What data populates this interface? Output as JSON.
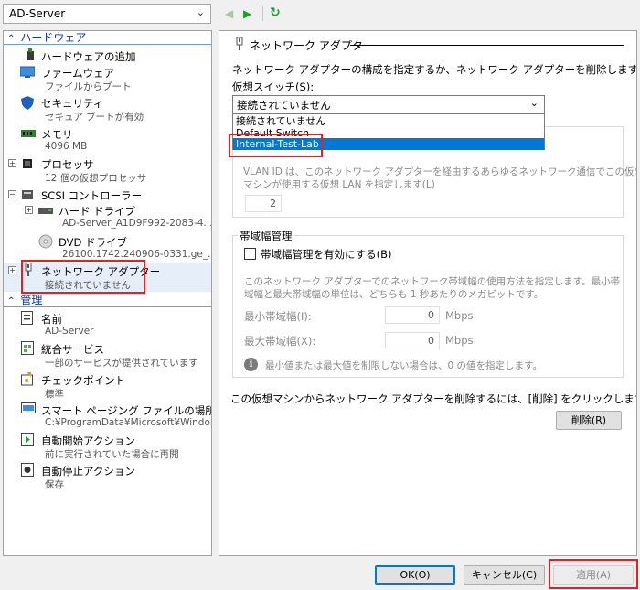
{
  "toolbar": {
    "vm_name": "AD-Server"
  },
  "left": {
    "hardware_header": "ハードウェア",
    "management_header": "管理",
    "hardware_items": [
      {
        "label": "ハードウェアの追加"
      },
      {
        "label": "ファームウェア",
        "sub": "ファイルからブート"
      },
      {
        "label": "セキュリティ",
        "sub": "セキュア ブートが有効"
      },
      {
        "label": "メモリ",
        "sub": "4096 MB"
      },
      {
        "label": "プロセッサ",
        "sub": "12 個の仮想プロセッサ"
      },
      {
        "label": "SCSI コントローラー"
      },
      {
        "label": "ハード ドライブ",
        "sub": "AD-Server_A1D9F992-2083-4..."
      },
      {
        "label": "DVD ドライブ",
        "sub": "26100.1742.240906-0331.ge_..."
      },
      {
        "label": "ネットワーク アダプター",
        "sub": "接続されていません"
      }
    ],
    "management_items": [
      {
        "label": "名前",
        "sub": "AD-Server"
      },
      {
        "label": "統合サービス",
        "sub": "一部のサービスが提供されています"
      },
      {
        "label": "チェックポイント",
        "sub": "標準"
      },
      {
        "label": "スマート ページング ファイルの場所",
        "sub": "C:¥ProgramData¥Microsoft¥Windo..."
      },
      {
        "label": "自動開始アクション",
        "sub": "前に実行されていた場合に再開"
      },
      {
        "label": "自動停止アクション",
        "sub": "保存"
      }
    ]
  },
  "right": {
    "title": "ネットワーク アダプター",
    "description": "ネットワーク アダプターの構成を指定するか、ネットワーク アダプターを削除します。",
    "virtual_switch_label": "仮想スイッチ(S):",
    "virtual_switch_value": "接続されていません",
    "switch_options": [
      "接続されていません",
      "Default Switch",
      "Internal-Test-Lab"
    ],
    "selected_option_index": 2,
    "vlan_desc_1": "VLAN ID は、このネットワーク アダプターを経由するあらゆるネットワーク通信でこの仮想",
    "vlan_desc_2": "マシンが使用する仮想 LAN を指定します(L)",
    "vlan_id": "2",
    "bandwidth_header": "帯域幅管理",
    "bandwidth_enable_label": "帯域幅管理を有効にする(B)",
    "bandwidth_enabled": false,
    "bandwidth_desc_1": "このネットワーク アダプターでのネットワーク帯域幅の使用方法を指定します。最小帯",
    "bandwidth_desc_2": "域幅と最大帯域幅の単位は、どちらも 1 秒あたりのメガビットです。",
    "min_bw_label": "最小帯域幅(I):",
    "min_bw_value": "0",
    "max_bw_label": "最大帯域幅(X):",
    "max_bw_value": "0",
    "unit": "Mbps",
    "info_text": "最小値または最大値を制限しない場合は、0 の値を指定します。",
    "remove_desc": "この仮想マシンからネットワーク アダプターを削除するには、[削除] をクリックします。",
    "remove_button": "削除(R)"
  },
  "buttons": {
    "ok": "OK(O)",
    "cancel": "キャンセル(C)",
    "apply": "適用(A)"
  },
  "colors": {
    "accent": "#0078d7",
    "highlight_box": "#e02424",
    "section_header": "#0b3d91"
  }
}
